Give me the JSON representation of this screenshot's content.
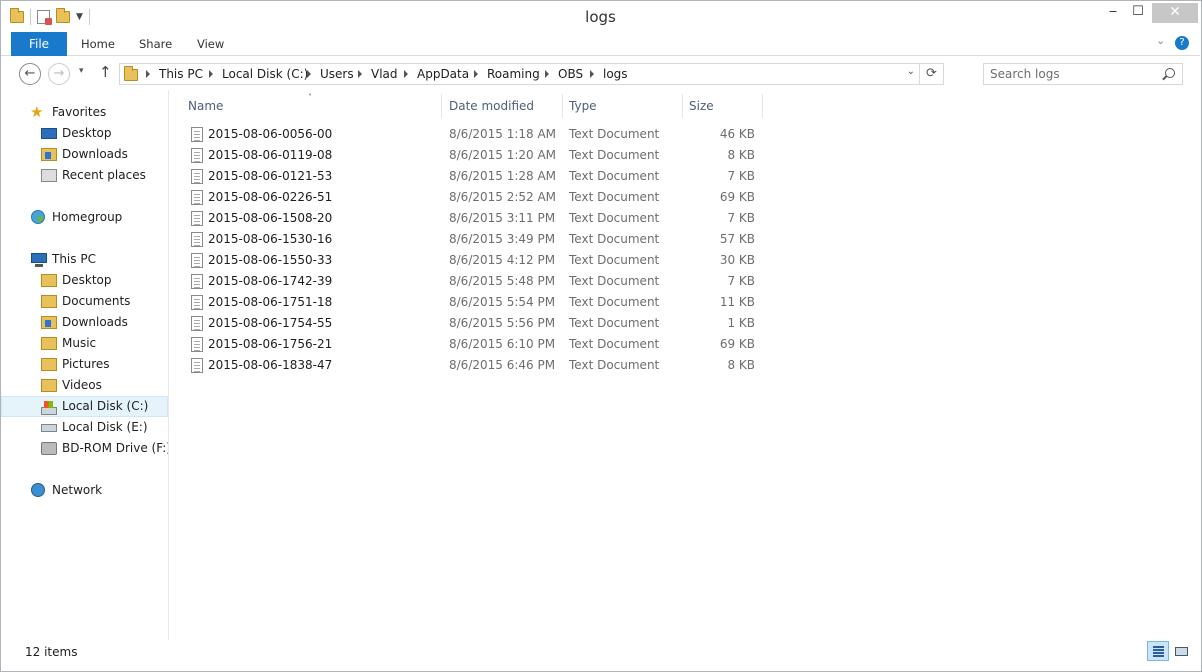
{
  "window": {
    "title": "logs",
    "controls": {
      "minimize": "‒",
      "maximize": "☐",
      "close": "✕"
    }
  },
  "ribbon": {
    "tabs": [
      "File",
      "Home",
      "Share",
      "View"
    ],
    "expand_glyph": "⌄",
    "help_glyph": "?"
  },
  "nav": {
    "back_glyph": "←",
    "forward_glyph": "→",
    "recent_glyph": "▾",
    "up_glyph": "↑",
    "breadcrumb": [
      "This PC",
      "Local Disk (C:)",
      "Users",
      "Vlad",
      "AppData",
      "Roaming",
      "OBS",
      "logs"
    ],
    "refresh_glyph": "⟳",
    "dropdown_glyph": "⌄",
    "search_placeholder": "Search logs"
  },
  "sidebar": {
    "favorites": {
      "label": "Favorites",
      "items": [
        "Desktop",
        "Downloads",
        "Recent places"
      ]
    },
    "homegroup": {
      "label": "Homegroup"
    },
    "this_pc": {
      "label": "This PC",
      "items": [
        "Desktop",
        "Documents",
        "Downloads",
        "Music",
        "Pictures",
        "Videos",
        "Local Disk (C:)",
        "Local Disk (E:)",
        "BD-ROM Drive (F:) V"
      ],
      "selected": "Local Disk (C:)"
    },
    "network": {
      "label": "Network"
    }
  },
  "file_list": {
    "columns": {
      "name": "Name",
      "date": "Date modified",
      "type": "Type",
      "size": "Size"
    },
    "sort_glyph": "˄",
    "rows": [
      {
        "name": "2015-08-06-0056-00",
        "date": "8/6/2015 1:18 AM",
        "type": "Text Document",
        "size": "46 KB"
      },
      {
        "name": "2015-08-06-0119-08",
        "date": "8/6/2015 1:20 AM",
        "type": "Text Document",
        "size": "8 KB"
      },
      {
        "name": "2015-08-06-0121-53",
        "date": "8/6/2015 1:28 AM",
        "type": "Text Document",
        "size": "7 KB"
      },
      {
        "name": "2015-08-06-0226-51",
        "date": "8/6/2015 2:52 AM",
        "type": "Text Document",
        "size": "69 KB"
      },
      {
        "name": "2015-08-06-1508-20",
        "date": "8/6/2015 3:11 PM",
        "type": "Text Document",
        "size": "7 KB"
      },
      {
        "name": "2015-08-06-1530-16",
        "date": "8/6/2015 3:49 PM",
        "type": "Text Document",
        "size": "57 KB"
      },
      {
        "name": "2015-08-06-1550-33",
        "date": "8/6/2015 4:12 PM",
        "type": "Text Document",
        "size": "30 KB"
      },
      {
        "name": "2015-08-06-1742-39",
        "date": "8/6/2015 5:48 PM",
        "type": "Text Document",
        "size": "7 KB"
      },
      {
        "name": "2015-08-06-1751-18",
        "date": "8/6/2015 5:54 PM",
        "type": "Text Document",
        "size": "11 KB"
      },
      {
        "name": "2015-08-06-1754-55",
        "date": "8/6/2015 5:56 PM",
        "type": "Text Document",
        "size": "1 KB"
      },
      {
        "name": "2015-08-06-1756-21",
        "date": "8/6/2015 6:10 PM",
        "type": "Text Document",
        "size": "69 KB"
      },
      {
        "name": "2015-08-06-1838-47",
        "date": "8/6/2015 6:46 PM",
        "type": "Text Document",
        "size": "8 KB"
      }
    ]
  },
  "status_bar": {
    "item_count": "12 items"
  },
  "colors": {
    "accent": "#1979ca",
    "selection": "#e5f3fb",
    "header_text": "#4c607a"
  }
}
